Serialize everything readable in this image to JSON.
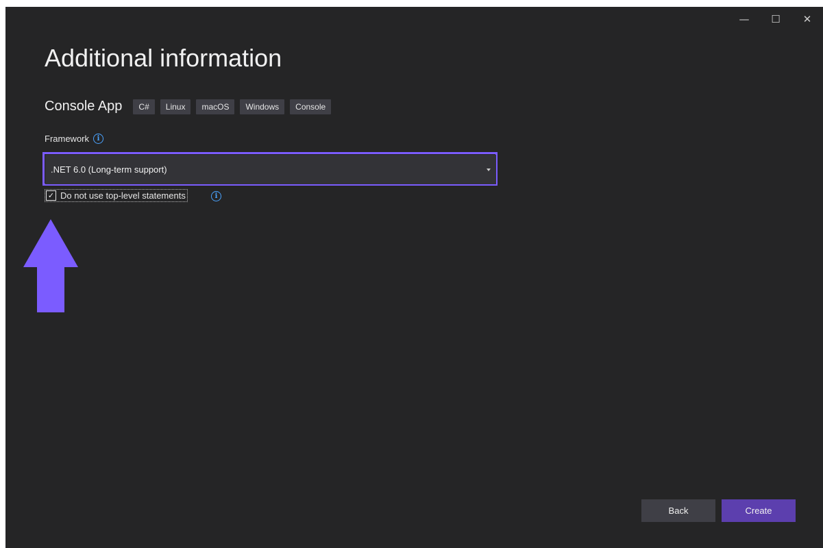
{
  "window": {
    "controls": {
      "minimize": "—",
      "maximize": "☐",
      "close": "✕"
    }
  },
  "page": {
    "title": "Additional information"
  },
  "template": {
    "name": "Console App",
    "tags": [
      "C#",
      "Linux",
      "macOS",
      "Windows",
      "Console"
    ]
  },
  "framework": {
    "label": "Framework",
    "selected_value": ".NET 6.0 (Long-term support)"
  },
  "options": {
    "top_level_statements": {
      "label": "Do not use top-level statements",
      "checked": true,
      "check_glyph": "✓"
    }
  },
  "info_icon_glyph": "i",
  "buttons": {
    "back": "Back",
    "create": "Create"
  },
  "colors": {
    "background": "#252526",
    "accent": "#5c3fae",
    "highlight": "#7b5cff",
    "info": "#4aa3ff"
  }
}
